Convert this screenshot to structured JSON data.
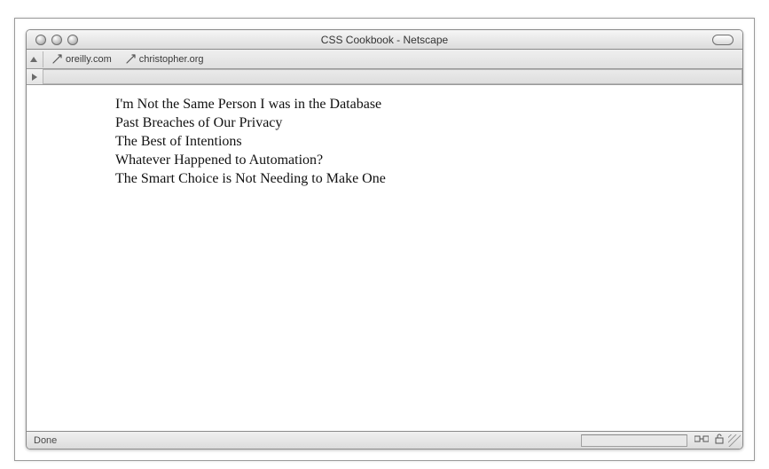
{
  "window": {
    "title": "CSS Cookbook - Netscape"
  },
  "toolbar": {
    "bookmarks": [
      {
        "label": "oreilly.com"
      },
      {
        "label": "christopher.org"
      }
    ]
  },
  "content": {
    "lines": [
      "I'm Not the Same Person I was in the Database",
      "Past Breaches of Our Privacy",
      "The Best of Intentions",
      "Whatever Happened to Automation?",
      "The Smart Choice is Not Needing to Make One"
    ]
  },
  "status": {
    "text": "Done"
  }
}
